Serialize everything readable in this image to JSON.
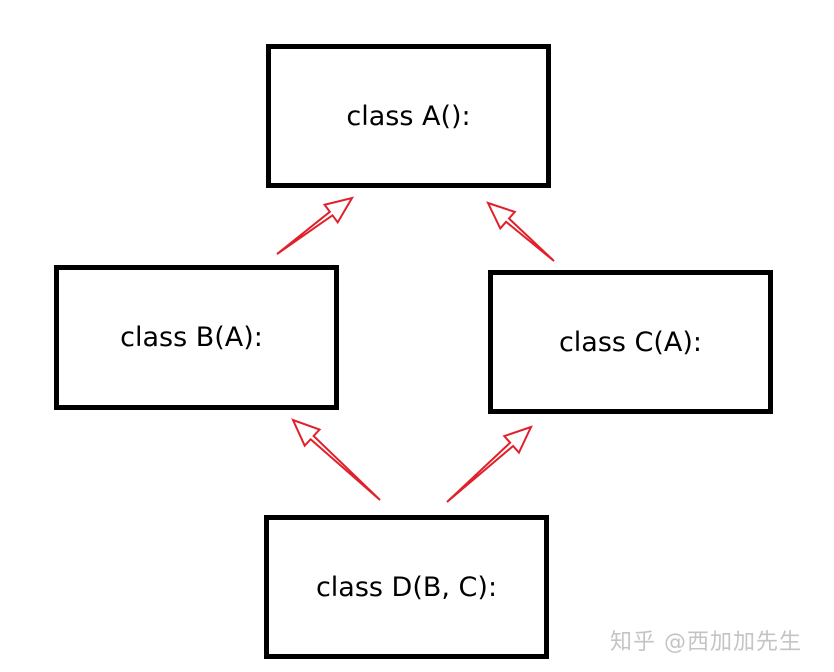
{
  "classes": {
    "a": "class A():",
    "b": "class B(A):",
    "c": "class C(A):",
    "d": "class D(B, C):"
  },
  "edges": [
    {
      "from": "b",
      "to": "a"
    },
    {
      "from": "c",
      "to": "a"
    },
    {
      "from": "d",
      "to": "b"
    },
    {
      "from": "d",
      "to": "c"
    }
  ],
  "colors": {
    "arrow": "#e0202a",
    "border": "#000000"
  },
  "watermark": "知乎 @西加加先生"
}
